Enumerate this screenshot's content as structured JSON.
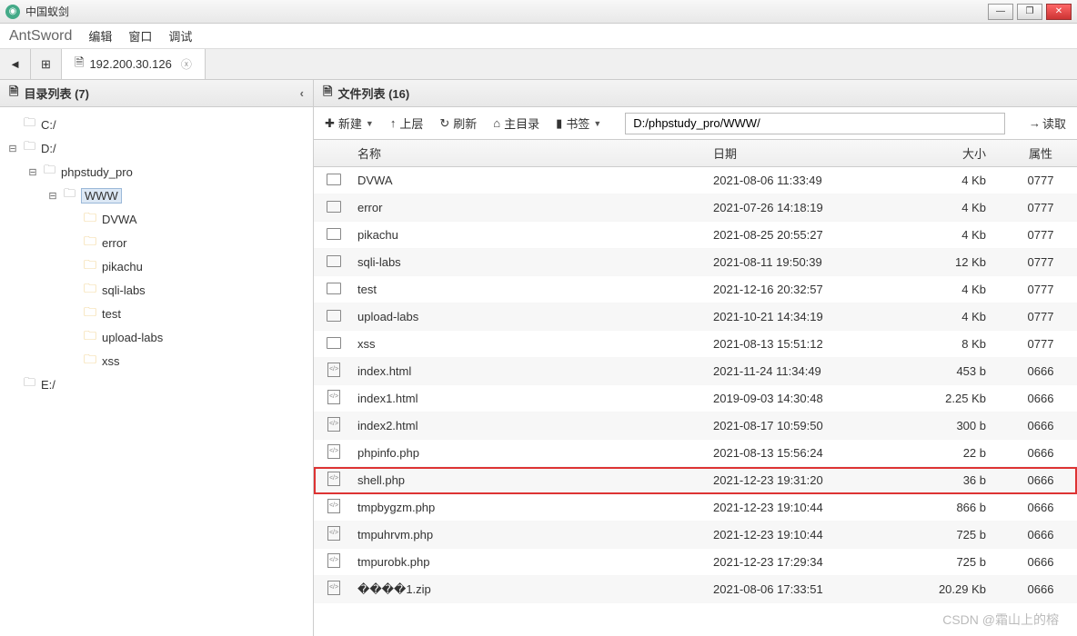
{
  "window": {
    "title": "中国蚁剑"
  },
  "winbuttons": {
    "min": "—",
    "max": "❐",
    "close": "✕"
  },
  "menu": {
    "brand": "AntSword",
    "edit": "编辑",
    "window": "窗口",
    "debug": "调试"
  },
  "tab": {
    "back": "◄",
    "grid": "⊞",
    "ip_label": "192.200.30.126",
    "close": "ⓧ",
    "doc_icon": "🗎"
  },
  "left": {
    "header_icon": "🗎",
    "header": "目录列表 (7)",
    "collapse": "‹",
    "drives": {
      "c": "C:/",
      "d": "D:/",
      "e": "E:/"
    },
    "phpstudy": "phpstudy_pro",
    "www": "WWW",
    "folders": [
      "DVWA",
      "error",
      "pikachu",
      "sqli-labs",
      "test",
      "upload-labs",
      "xss"
    ]
  },
  "right": {
    "header_icon": "🗎",
    "header": "文件列表 (16)",
    "toolbar": {
      "new_icon": "✚",
      "new": "新建",
      "up_icon": "↑",
      "up": "上层",
      "refresh_icon": "↻",
      "refresh": "刷新",
      "home_icon": "⌂",
      "home": "主目录",
      "bookmark_icon": "▮",
      "bookmark": "书签",
      "path": "D:/phpstudy_pro/WWW/",
      "read_icon": "→",
      "read": "读取"
    },
    "columns": {
      "name": "名称",
      "date": "日期",
      "size": "大小",
      "attr": "属性"
    },
    "files": [
      {
        "type": "folder",
        "name": "DVWA",
        "date": "2021-08-06 11:33:49",
        "size": "4 Kb",
        "attr": "0777"
      },
      {
        "type": "folder",
        "name": "error",
        "date": "2021-07-26 14:18:19",
        "size": "4 Kb",
        "attr": "0777"
      },
      {
        "type": "folder",
        "name": "pikachu",
        "date": "2021-08-25 20:55:27",
        "size": "4 Kb",
        "attr": "0777"
      },
      {
        "type": "folder",
        "name": "sqli-labs",
        "date": "2021-08-11 19:50:39",
        "size": "12 Kb",
        "attr": "0777"
      },
      {
        "type": "folder",
        "name": "test",
        "date": "2021-12-16 20:32:57",
        "size": "4 Kb",
        "attr": "0777"
      },
      {
        "type": "folder",
        "name": "upload-labs",
        "date": "2021-10-21 14:34:19",
        "size": "4 Kb",
        "attr": "0777"
      },
      {
        "type": "folder",
        "name": "xss",
        "date": "2021-08-13 15:51:12",
        "size": "8 Kb",
        "attr": "0777"
      },
      {
        "type": "file",
        "name": "index.html",
        "date": "2021-11-24 11:34:49",
        "size": "453 b",
        "attr": "0666"
      },
      {
        "type": "file",
        "name": "index1.html",
        "date": "2019-09-03 14:30:48",
        "size": "2.25 Kb",
        "attr": "0666"
      },
      {
        "type": "file",
        "name": "index2.html",
        "date": "2021-08-17 10:59:50",
        "size": "300 b",
        "attr": "0666"
      },
      {
        "type": "file",
        "name": "phpinfo.php",
        "date": "2021-08-13 15:56:24",
        "size": "22 b",
        "attr": "0666"
      },
      {
        "type": "file",
        "name": "shell.php",
        "date": "2021-12-23 19:31:20",
        "size": "36 b",
        "attr": "0666",
        "highlight": true
      },
      {
        "type": "file",
        "name": "tmpbygzm.php",
        "date": "2021-12-23 19:10:44",
        "size": "866 b",
        "attr": "0666"
      },
      {
        "type": "file",
        "name": "tmpuhrvm.php",
        "date": "2021-12-23 19:10:44",
        "size": "725 b",
        "attr": "0666"
      },
      {
        "type": "file",
        "name": "tmpurobk.php",
        "date": "2021-12-23 17:29:34",
        "size": "725 b",
        "attr": "0666"
      },
      {
        "type": "file",
        "name": "����1.zip",
        "date": "2021-08-06 17:33:51",
        "size": "20.29 Kb",
        "attr": "0666"
      }
    ]
  },
  "watermark": "CSDN @霜山上的榕"
}
